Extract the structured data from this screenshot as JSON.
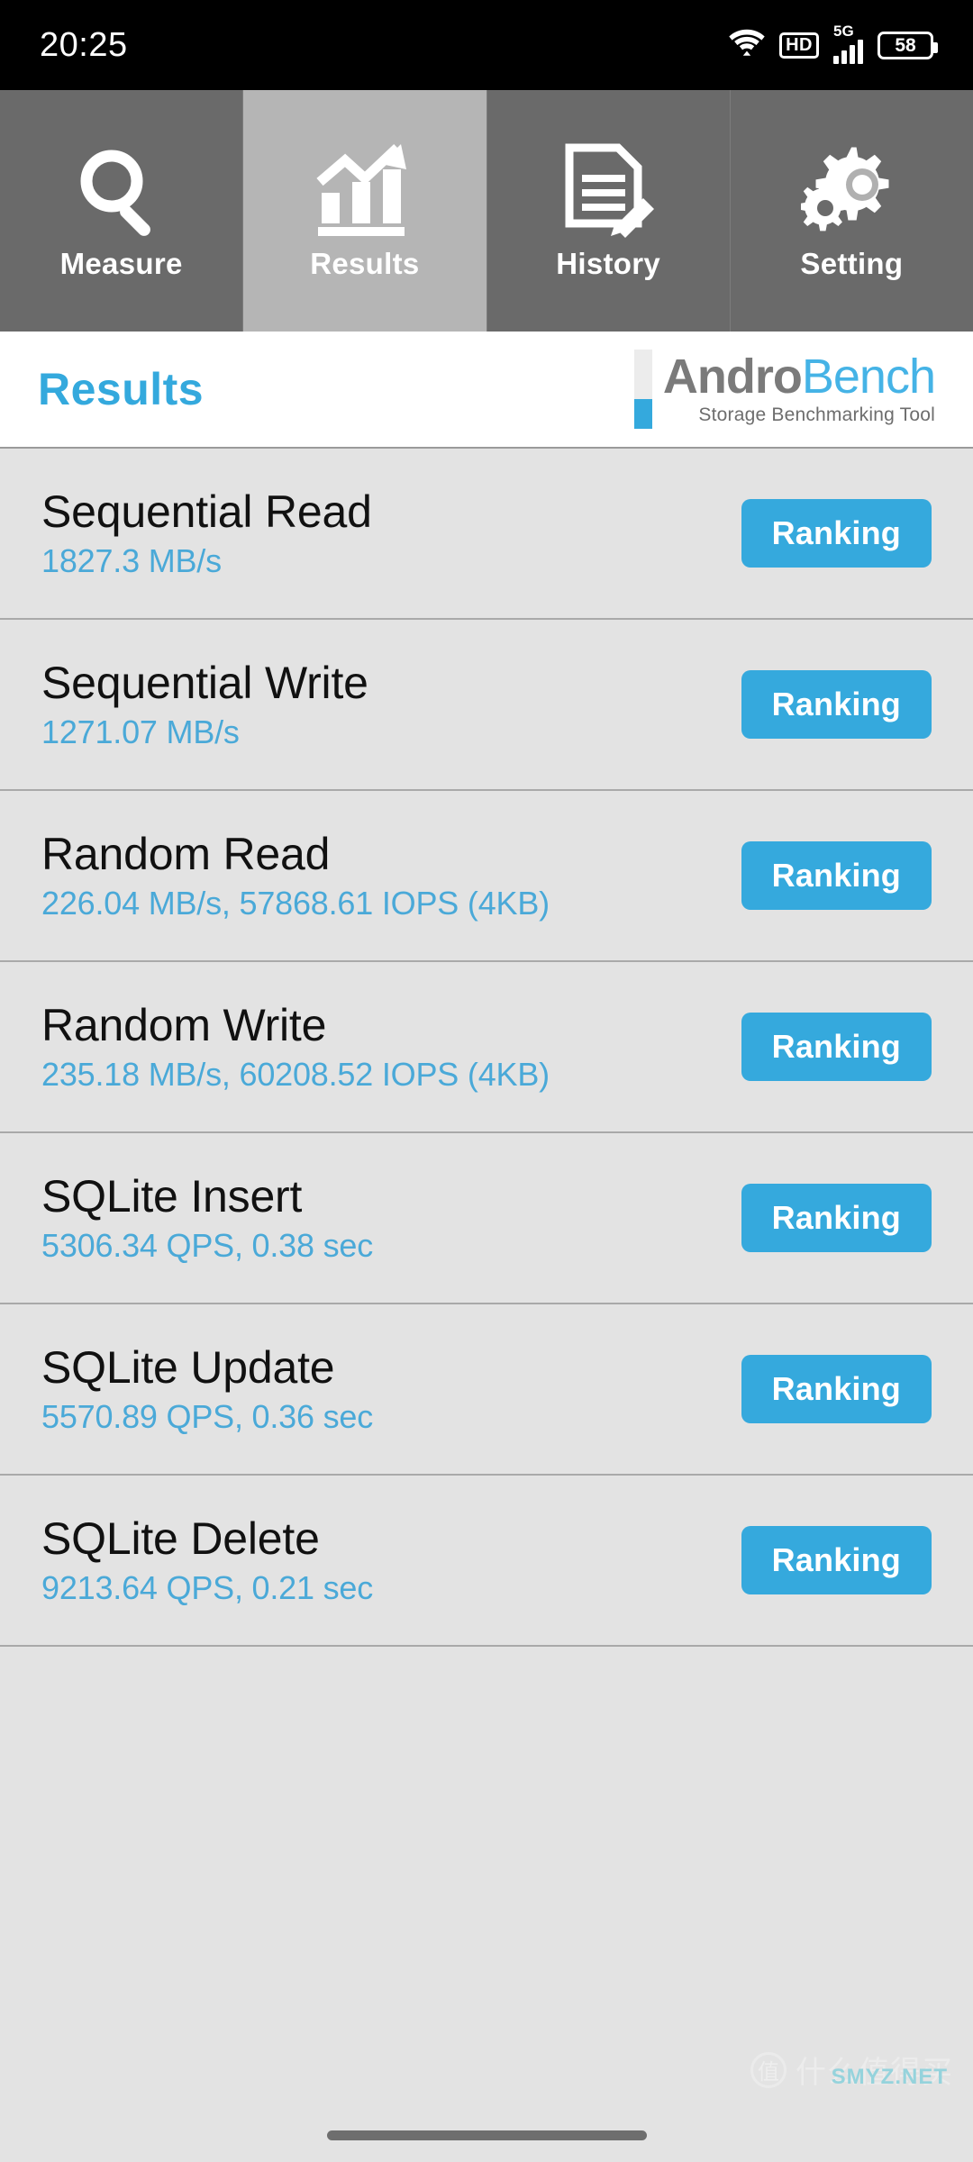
{
  "status_bar": {
    "time": "20:25",
    "wifi_icon": "wifi-icon",
    "hd_label": "HD",
    "network_label": "5G",
    "battery_level": "58"
  },
  "tabs": [
    {
      "label": "Measure",
      "icon": "magnifier-icon",
      "active": false
    },
    {
      "label": "Results",
      "icon": "bar-chart-arrow-icon",
      "active": true
    },
    {
      "label": "History",
      "icon": "document-pencil-icon",
      "active": false
    },
    {
      "label": "Setting",
      "icon": "gears-icon",
      "active": false
    }
  ],
  "header": {
    "page_title": "Results",
    "logo_name_gray": "Andro",
    "logo_name_blue": "Bench",
    "logo_tagline": "Storage Benchmarking Tool"
  },
  "results": [
    {
      "title": "Sequential Read",
      "value": "1827.3 MB/s",
      "button": "Ranking"
    },
    {
      "title": "Sequential Write",
      "value": "1271.07 MB/s",
      "button": "Ranking"
    },
    {
      "title": "Random Read",
      "value": "226.04 MB/s, 57868.61 IOPS (4KB)",
      "button": "Ranking"
    },
    {
      "title": "Random Write",
      "value": "235.18 MB/s, 60208.52 IOPS (4KB)",
      "button": "Ranking"
    },
    {
      "title": "SQLite Insert",
      "value": "5306.34 QPS, 0.38 sec",
      "button": "Ranking"
    },
    {
      "title": "SQLite Update",
      "value": "5570.89 QPS, 0.36 sec",
      "button": "Ranking"
    },
    {
      "title": "SQLite Delete",
      "value": "9213.64 QPS, 0.21 sec",
      "button": "Ranking"
    }
  ],
  "watermark": {
    "mark": "值",
    "text": "什么值得买",
    "domain": "SMYZ.NET"
  },
  "colors": {
    "accent_blue": "#35a9dd",
    "value_blue": "#4aa9d8",
    "tab_inactive": "#6a6a6a",
    "tab_active": "#b5b5b5",
    "row_bg": "#e3e3e3",
    "logo_gray": "#7a7a7a"
  }
}
